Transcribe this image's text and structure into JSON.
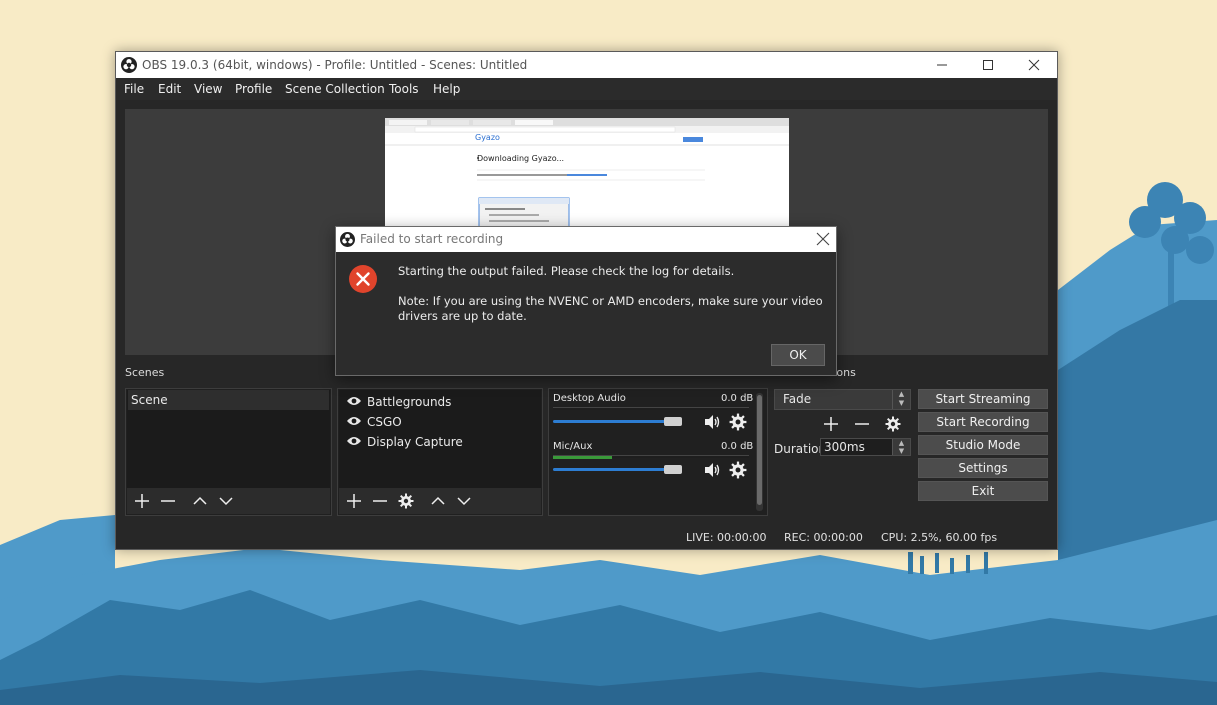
{
  "window": {
    "title": "OBS 19.0.3 (64bit, windows) - Profile: Untitled - Scenes: Untitled"
  },
  "menu": [
    "File",
    "Edit",
    "View",
    "Profile",
    "Scene Collection",
    "Tools",
    "Help"
  ],
  "preview": {
    "captured_page_heading": "Downloading Gyazo...",
    "captured_logo": "Gyazo"
  },
  "scenes": {
    "label": "Scenes",
    "items": [
      "Scene"
    ]
  },
  "sources": {
    "items": [
      "Battlegrounds",
      "CSGO",
      "Display Capture"
    ]
  },
  "mixer": {
    "channels": [
      {
        "name": "Desktop Audio",
        "db": "0.0 dB",
        "level": 0.0,
        "volume": 0.82
      },
      {
        "name": "Mic/Aux",
        "db": "0.0 dB",
        "level": 0.3,
        "volume": 0.82
      }
    ]
  },
  "transitions": {
    "label_fragment": "tions",
    "selected": "Fade",
    "duration_label": "Duration",
    "duration_value": "300ms"
  },
  "controls": [
    "Start Streaming",
    "Start Recording",
    "Studio Mode",
    "Settings",
    "Exit"
  ],
  "status": {
    "live": "LIVE: 00:00:00",
    "rec": "REC: 00:00:00",
    "cpu": "CPU: 2.5%, 60.00 fps"
  },
  "dialog": {
    "title": "Failed to start recording",
    "message": "Starting the output failed.  Please check the log for details.",
    "note": "Note: If you are using the NVENC or AMD encoders, make sure your video drivers are up to date.",
    "ok": "OK"
  },
  "colors": {
    "wallpaper_sky": "#f8ebc6",
    "wallpaper_hills_light": "#4f9ac9",
    "wallpaper_hills_dark": "#2c6f98",
    "obs_dark": "#272727",
    "slider_blue": "#2d7dd2",
    "error_red": "#e0442c"
  }
}
